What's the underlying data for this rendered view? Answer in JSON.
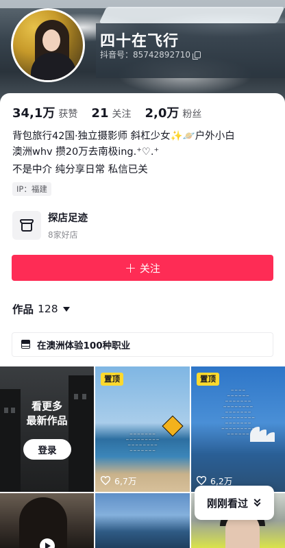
{
  "profile": {
    "nickname": "四十在飞行",
    "douyin_id": "抖音号：85742892710",
    "stats": [
      {
        "value": "34,1万",
        "label": "获赞"
      },
      {
        "value": "21",
        "label": "关注"
      },
      {
        "value": "2,0万",
        "label": "粉丝"
      }
    ],
    "bio_lines": [
      "背包旅行42国·独立摄影师 斜杠少女✨🪐户外小白",
      "澳洲whv 攒20万去南极ing.⁺♡.⁺",
      "不是中介 纯分享日常 私信已关"
    ],
    "ip": "IP：福建"
  },
  "store": {
    "title": "探店足迹",
    "subtitle": "8家好店",
    "icon": "storefront-icon"
  },
  "follow_button": {
    "label": "关注",
    "icon": "plus-icon",
    "color": "#fe2c55"
  },
  "works": {
    "label": "作品",
    "count": "128"
  },
  "collection": {
    "label": "在澳洲体验100种职业",
    "icon": "stack-icon"
  },
  "grid": {
    "login_card": {
      "line1": "看更多",
      "line2": "最新作品",
      "button": "登录"
    },
    "pinned_label": "置顶",
    "videos": [
      {
        "likes": "6,7万"
      },
      {
        "likes": "6,2万"
      }
    ]
  },
  "recent_button": {
    "label": "刚刚看过",
    "icon": "double-chevron-down-icon"
  },
  "colors": {
    "accent": "#fe2c55",
    "pin": "#fdd92e"
  }
}
